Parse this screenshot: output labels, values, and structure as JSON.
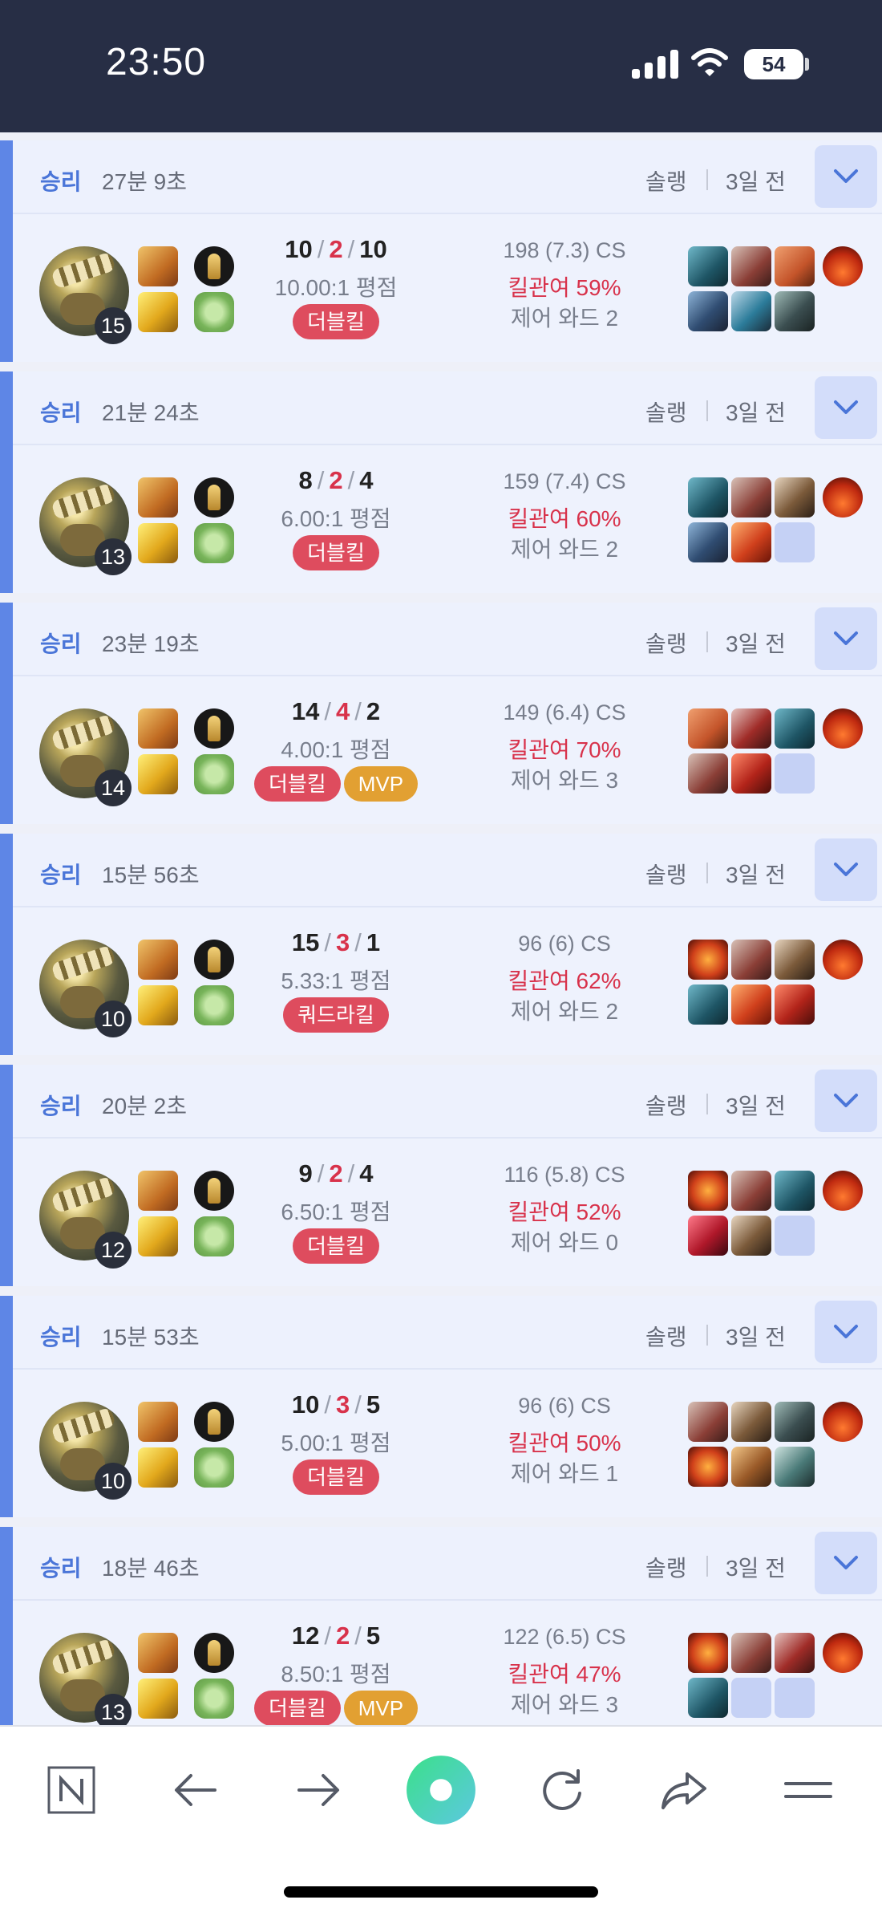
{
  "status_bar": {
    "time": "23:50",
    "battery": "54"
  },
  "list": {
    "queue_label": "솔랭",
    "matches": [
      {
        "result": "승리",
        "duration": "27분 9초",
        "ago": "3일 전",
        "level": "15",
        "kda": {
          "k": "10",
          "d": "2",
          "a": "10"
        },
        "ratio": "10.00:1 평점",
        "badges": [
          "더블킬"
        ],
        "cs": "198 (7.3) CS",
        "kill_participation": "킬관여 59%",
        "control_wards": "제어 와드 2"
      },
      {
        "result": "승리",
        "duration": "21분 24초",
        "ago": "3일 전",
        "level": "13",
        "kda": {
          "k": "8",
          "d": "2",
          "a": "4"
        },
        "ratio": "6.00:1 평점",
        "badges": [
          "더블킬"
        ],
        "cs": "159 (7.4) CS",
        "kill_participation": "킬관여 60%",
        "control_wards": "제어 와드 2"
      },
      {
        "result": "승리",
        "duration": "23분 19초",
        "ago": "3일 전",
        "level": "14",
        "kda": {
          "k": "14",
          "d": "4",
          "a": "2"
        },
        "ratio": "4.00:1 평점",
        "badges": [
          "더블킬",
          "MVP"
        ],
        "cs": "149 (6.4) CS",
        "kill_participation": "킬관여 70%",
        "control_wards": "제어 와드 3"
      },
      {
        "result": "승리",
        "duration": "15분 56초",
        "ago": "3일 전",
        "level": "10",
        "kda": {
          "k": "15",
          "d": "3",
          "a": "1"
        },
        "ratio": "5.33:1 평점",
        "badges": [
          "쿼드라킬"
        ],
        "cs": "96 (6) CS",
        "kill_participation": "킬관여 62%",
        "control_wards": "제어 와드 2"
      },
      {
        "result": "승리",
        "duration": "20분 2초",
        "ago": "3일 전",
        "level": "12",
        "kda": {
          "k": "9",
          "d": "2",
          "a": "4"
        },
        "ratio": "6.50:1 평점",
        "badges": [
          "더블킬"
        ],
        "cs": "116 (5.8) CS",
        "kill_participation": "킬관여 52%",
        "control_wards": "제어 와드 0"
      },
      {
        "result": "승리",
        "duration": "15분 53초",
        "ago": "3일 전",
        "level": "10",
        "kda": {
          "k": "10",
          "d": "3",
          "a": "5"
        },
        "ratio": "5.00:1 평점",
        "badges": [
          "더블킬"
        ],
        "cs": "96 (6) CS",
        "kill_participation": "킬관여 50%",
        "control_wards": "제어 와드 1"
      },
      {
        "result": "승리",
        "duration": "18분 46초",
        "ago": "3일 전",
        "level": "13",
        "kda": {
          "k": "12",
          "d": "2",
          "a": "5"
        },
        "ratio": "8.50:1 평점",
        "badges": [
          "더블킬",
          "MVP"
        ],
        "cs": "122 (6.5) CS",
        "kill_participation": "킬관여 47%",
        "control_wards": "제어 와드 3"
      }
    ]
  },
  "colors": {
    "accent": "#5e86e6",
    "win_text": "#4a75d8",
    "death": "#d8324b",
    "mvp": "#e2a032",
    "status_bar": "#272e45"
  },
  "icons": {
    "expand": "chevron-down-icon",
    "nav": [
      "naver-n-icon",
      "back-arrow-icon",
      "forward-arrow-icon",
      "green-dot-home-icon",
      "refresh-icon",
      "share-icon",
      "menu-icon"
    ]
  }
}
